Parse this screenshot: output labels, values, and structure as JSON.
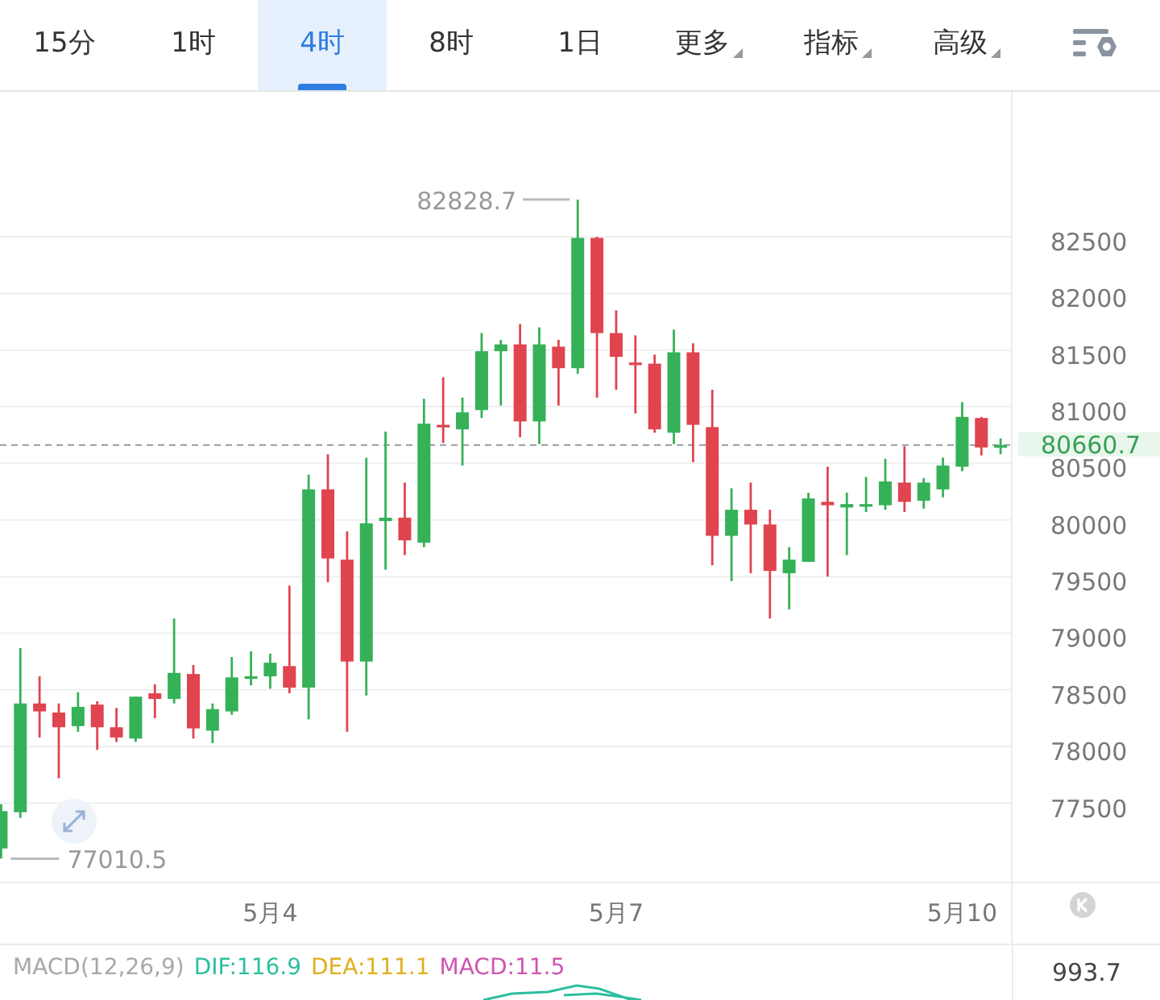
{
  "tabs": [
    {
      "label": "15分",
      "selected": false,
      "caret": false
    },
    {
      "label": "1时",
      "selected": false,
      "caret": false
    },
    {
      "label": "4时",
      "selected": true,
      "caret": false
    },
    {
      "label": "8时",
      "selected": false,
      "caret": false
    },
    {
      "label": "1日",
      "selected": false,
      "caret": false
    },
    {
      "label": "更多",
      "selected": false,
      "caret": true
    },
    {
      "label": "指标",
      "selected": false,
      "caret": true
    },
    {
      "label": "高级",
      "selected": false,
      "caret": true
    }
  ],
  "price_chart": {
    "chart_data": {
      "type": "candlestick",
      "categories": [
        null,
        null,
        null,
        null,
        null,
        null,
        null,
        null,
        null,
        null,
        null,
        null,
        null,
        null,
        "5月4",
        null,
        null,
        null,
        null,
        null,
        null,
        null,
        null,
        null,
        null,
        null,
        null,
        null,
        null,
        null,
        null,
        null,
        "5月7",
        null,
        null,
        null,
        null,
        null,
        null,
        null,
        null,
        null,
        null,
        null,
        null,
        null,
        null,
        null,
        null,
        null,
        "5月10",
        null,
        null
      ],
      "ohlc": [
        [
          77100,
          77490,
          77010.5,
          77430
        ],
        [
          77420,
          78870,
          77370,
          78380
        ],
        [
          78380,
          78620,
          78080,
          78310
        ],
        [
          78300,
          78380,
          77720,
          78170
        ],
        [
          78180,
          78480,
          78130,
          78350
        ],
        [
          78370,
          78400,
          77970,
          78170
        ],
        [
          78170,
          78340,
          78040,
          78080
        ],
        [
          78070,
          78440,
          78040,
          78440
        ],
        [
          78470,
          78550,
          78250,
          78420
        ],
        [
          78420,
          79130,
          78380,
          78650
        ],
        [
          78640,
          78720,
          78070,
          78160
        ],
        [
          78140,
          78380,
          78030,
          78330
        ],
        [
          78310,
          78790,
          78280,
          78610
        ],
        [
          78610,
          78840,
          78540,
          78620
        ],
        [
          78620,
          78820,
          78510,
          78740
        ],
        [
          78710,
          79420,
          78470,
          78520
        ],
        [
          78520,
          80400,
          78240,
          80270
        ],
        [
          80270,
          80580,
          79450,
          79660
        ],
        [
          79650,
          79900,
          78130,
          78750
        ],
        [
          78750,
          80550,
          78450,
          79970
        ],
        [
          79990,
          80780,
          79560,
          80020
        ],
        [
          80020,
          80330,
          79690,
          79820
        ],
        [
          79800,
          81070,
          79760,
          80850
        ],
        [
          80840,
          81260,
          80680,
          80820
        ],
        [
          80800,
          81080,
          80480,
          80950
        ],
        [
          80970,
          81650,
          80900,
          81490
        ],
        [
          81490,
          81590,
          81010,
          81550
        ],
        [
          81550,
          81730,
          80730,
          80870
        ],
        [
          80870,
          81700,
          80670,
          81550
        ],
        [
          81530,
          81590,
          81010,
          81340
        ],
        [
          81340,
          82828.7,
          81290,
          82490
        ],
        [
          82490,
          82500,
          81080,
          81650
        ],
        [
          81650,
          81850,
          81150,
          81440
        ],
        [
          81390,
          81630,
          80940,
          81380
        ],
        [
          81380,
          81460,
          80770,
          80800
        ],
        [
          80770,
          81680,
          80670,
          81480
        ],
        [
          81480,
          81560,
          80510,
          80840
        ],
        [
          80820,
          81150,
          79600,
          79860
        ],
        [
          79860,
          80280,
          79460,
          80090
        ],
        [
          80090,
          80330,
          79530,
          79960
        ],
        [
          79960,
          80090,
          79130,
          79550
        ],
        [
          79530,
          79760,
          79210,
          79650
        ],
        [
          79630,
          80240,
          79630,
          80190
        ],
        [
          80160,
          80470,
          79500,
          80130
        ],
        [
          80110,
          80240,
          79690,
          80140
        ],
        [
          80130,
          80380,
          80070,
          80140
        ],
        [
          80130,
          80540,
          80090,
          80340
        ],
        [
          80330,
          80650,
          80070,
          80160
        ],
        [
          80170,
          80370,
          80100,
          80330
        ],
        [
          80270,
          80550,
          80200,
          80480
        ],
        [
          80470,
          81040,
          80430,
          80910
        ],
        [
          80900,
          80910,
          80570,
          80640
        ],
        [
          80650,
          80720,
          80580,
          80660.7
        ]
      ],
      "ylim": [
        76800,
        83780
      ],
      "yticks": [
        77500,
        78000,
        78500,
        79000,
        79500,
        80000,
        80500,
        81000,
        81500,
        82000,
        82500
      ],
      "grid": true,
      "annotations": [
        "82828.7",
        "77010.5"
      ],
      "ref_lines": [
        {
          "axis": "y",
          "value": 80660.7,
          "label": "80660.7"
        }
      ]
    }
  },
  "macd": {
    "legend": [
      {
        "text": "MACD(12,26,9)",
        "color": "#a8a8a8"
      },
      {
        "text": "DIF:116.9",
        "color": "#2bbfa0"
      },
      {
        "text": "DEA:111.1",
        "color": "#e0b020"
      },
      {
        "text": "MACD:11.5",
        "color": "#d054b0"
      }
    ],
    "axis_label": "993.7"
  }
}
